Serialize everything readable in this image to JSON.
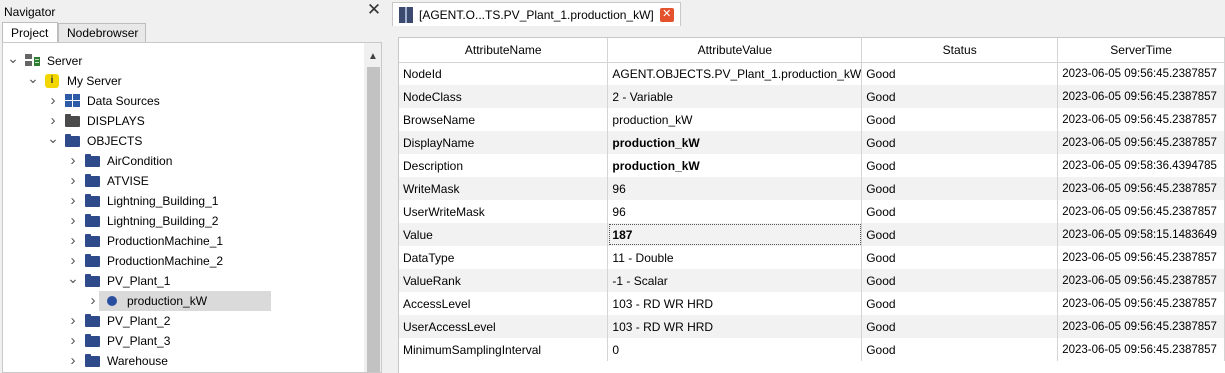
{
  "navigator": {
    "title": "Navigator",
    "tabs": [
      "Project",
      "Nodebrowser"
    ],
    "tree": [
      {
        "label": "Server",
        "icon": "server-icon",
        "expanded": true
      },
      {
        "label": "My Server",
        "icon": "my-server-icon",
        "expanded": true
      },
      {
        "label": "Data Sources",
        "icon": "grid-icon",
        "expanded": false
      },
      {
        "label": "DISPLAYS",
        "icon": "folder-dark-icon",
        "expanded": false
      },
      {
        "label": "OBJECTS",
        "icon": "folder-icon",
        "expanded": true
      },
      {
        "label": "AirCondition",
        "icon": "folder-icon",
        "expanded": false
      },
      {
        "label": "ATVISE",
        "icon": "folder-icon",
        "expanded": false
      },
      {
        "label": "Lightning_Building_1",
        "icon": "folder-icon",
        "expanded": false
      },
      {
        "label": "Lightning_Building_2",
        "icon": "folder-icon",
        "expanded": false
      },
      {
        "label": "ProductionMachine_1",
        "icon": "folder-icon",
        "expanded": false
      },
      {
        "label": "ProductionMachine_2",
        "icon": "folder-icon",
        "expanded": false
      },
      {
        "label": "PV_Plant_1",
        "icon": "folder-icon",
        "expanded": true
      },
      {
        "label": "production_kW",
        "icon": "variable-node-icon",
        "expanded": false,
        "selected": true
      },
      {
        "label": "PV_Plant_2",
        "icon": "folder-icon",
        "expanded": false
      },
      {
        "label": "PV_Plant_3",
        "icon": "folder-icon",
        "expanded": false
      },
      {
        "label": "Warehouse",
        "icon": "folder-icon",
        "expanded": false
      }
    ]
  },
  "editor": {
    "tab_title": "[AGENT.O...TS.PV_Plant_1.production_kW]",
    "columns": [
      "AttributeName",
      "AttributeValue",
      "Status",
      "ServerTime"
    ],
    "rows": [
      {
        "name": "NodeId",
        "value": "AGENT.OBJECTS.PV_Plant_1.production_kW",
        "status": "Good",
        "time": "2023-06-05 09:56:45.2387857"
      },
      {
        "name": "NodeClass",
        "value": "2 - Variable",
        "status": "Good",
        "time": "2023-06-05 09:56:45.2387857"
      },
      {
        "name": "BrowseName",
        "value": "production_kW",
        "status": "Good",
        "time": "2023-06-05 09:56:45.2387857"
      },
      {
        "name": "DisplayName",
        "value": "production_kW",
        "status": "Good",
        "time": "2023-06-05 09:56:45.2387857",
        "bold": true
      },
      {
        "name": "Description",
        "value": "production_kW",
        "status": "Good",
        "time": "2023-06-05 09:58:36.4394785",
        "bold": true
      },
      {
        "name": "WriteMask",
        "value": "96",
        "status": "Good",
        "time": "2023-06-05 09:56:45.2387857"
      },
      {
        "name": "UserWriteMask",
        "value": "96",
        "status": "Good",
        "time": "2023-06-05 09:56:45.2387857"
      },
      {
        "name": "Value",
        "value": "187",
        "status": "Good",
        "time": "2023-06-05 09:58:15.1483649",
        "bold": true,
        "focused": true
      },
      {
        "name": "DataType",
        "value": "11 - Double",
        "status": "Good",
        "time": "2023-06-05 09:56:45.2387857"
      },
      {
        "name": "ValueRank",
        "value": "-1 - Scalar",
        "status": "Good",
        "time": "2023-06-05 09:56:45.2387857"
      },
      {
        "name": "AccessLevel",
        "value": "103 - RD WR HRD",
        "status": "Good",
        "time": "2023-06-05 09:56:45.2387857"
      },
      {
        "name": "UserAccessLevel",
        "value": "103 - RD WR HRD",
        "status": "Good",
        "time": "2023-06-05 09:56:45.2387857"
      },
      {
        "name": "MinimumSamplingInterval",
        "value": "0",
        "status": "Good",
        "time": "2023-06-05 09:56:45.2387857"
      }
    ]
  }
}
